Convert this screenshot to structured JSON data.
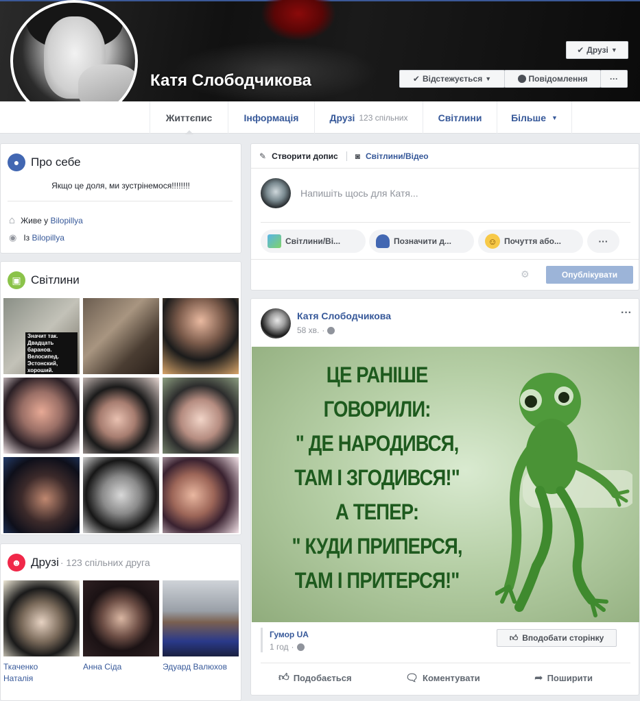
{
  "profile": {
    "name": "Катя Слободчикова",
    "friends_button": "Друзі",
    "follow_button": "Відстежується",
    "message_button": "Повідомлення",
    "more_button": "···"
  },
  "nav": {
    "tabs": [
      {
        "label": "Життєпис"
      },
      {
        "label": "Інформація"
      },
      {
        "label": "Друзі",
        "sub": "123 спільних"
      },
      {
        "label": "Світлини"
      },
      {
        "label": "Більше"
      }
    ]
  },
  "about": {
    "title": "Про себе",
    "bio": "Якщо це доля, ми зустрінемося!!!!!!!!",
    "lives_prefix": "Живе у",
    "lives_place": "Bilopillya",
    "from_prefix": "Із",
    "from_place": "Bilopillya"
  },
  "photos": {
    "title": "Світлини",
    "meme_caption": "Значит так. Двадцать баранов. Велосипед. Эстонский, хороший. Почетная грамота"
  },
  "friends": {
    "title": "Друзі",
    "subtitle": "· 123 спільних друга",
    "items": [
      {
        "name_line1": "Ткаченко",
        "name_line2": "Наталія"
      },
      {
        "name_line1": "Анна Сіда",
        "name_line2": ""
      },
      {
        "name_line1": "Эдуард Валюхов",
        "name_line2": ""
      }
    ]
  },
  "composer": {
    "create_post": "Створити допис",
    "photo_video": "Світлини/Відео",
    "placeholder": "Напишіть щось для Катя...",
    "pill_photo": "Світлини/Ві...",
    "pill_tag": "Позначити д...",
    "pill_feeling": "Почуття або...",
    "pill_more": "···",
    "publish": "Опублікувати"
  },
  "post": {
    "author": "Катя Слободчикова",
    "time": "58 хв.",
    "image_text": [
      "ЦЕ РАНІШЕ",
      "ГОВОРИЛИ:",
      "\" ДЕ НАРОДИВСЯ,",
      "ТАМ І ЗГОДИВСЯ!\"",
      "А ТЕПЕР:",
      "\" КУДИ ПРИПЕРСЯ,",
      "ТАМ І ПРИТЕРСЯ!\""
    ],
    "page_name": "Гумор UA",
    "page_time": "1 год",
    "like_page": "Вподобати сторінку",
    "like": "Подобається",
    "comment": "Коментувати",
    "share": "Поширити",
    "menu": "···"
  },
  "colors": {
    "brand": "#3b5998",
    "link": "#365899",
    "publish_disabled": "#9cb4d8",
    "image_green": "#9db98a",
    "text_green": "#1e5a1e"
  }
}
